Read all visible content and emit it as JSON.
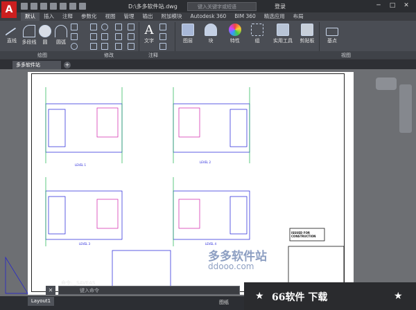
{
  "titlebar": {
    "app_logo": "A",
    "doc_title": "D:\\多多软件站.dwg",
    "search_placeholder": "键入关键字或短语",
    "login": "登录",
    "minimize": "─",
    "maximize": "□",
    "close": "✕"
  },
  "tabs": [
    "默认",
    "插入",
    "注释",
    "参数化",
    "视图",
    "管理",
    "输出",
    "附加模块",
    "Autodesk 360",
    "BIM 360",
    "精选应用",
    "布局"
  ],
  "ribbon": {
    "draw": {
      "line": "直线",
      "polyline": "多段线",
      "circle": "圆",
      "arc": "圆弧",
      "group_label": "绘图"
    },
    "modify_label": "修改",
    "text": "文字",
    "annotate_label": "注释",
    "layer": "图层",
    "block": "块",
    "properties": "特性",
    "group": "组",
    "utilities": "实用工具",
    "clipboard": "剪贴板",
    "base": "基点",
    "view_label": "视图"
  },
  "doctab": {
    "active": "多多软件站",
    "add": "+"
  },
  "command": {
    "history": "命令: _SAVEAS",
    "placeholder": "键入命令",
    "close": "✕"
  },
  "statusbar": {
    "layout": "Layout1",
    "model": "图纸"
  },
  "watermark": {
    "text": "多多软件站",
    "url": "ddooo.com",
    "banner": "66软件 下载"
  },
  "drawing": {
    "level_labels": [
      "LEVEL 1",
      "LEVEL 2",
      "LEVEL 3",
      "LEVEL 4"
    ],
    "issued_text": "ISSUED FOR CONSTRUCTION"
  }
}
